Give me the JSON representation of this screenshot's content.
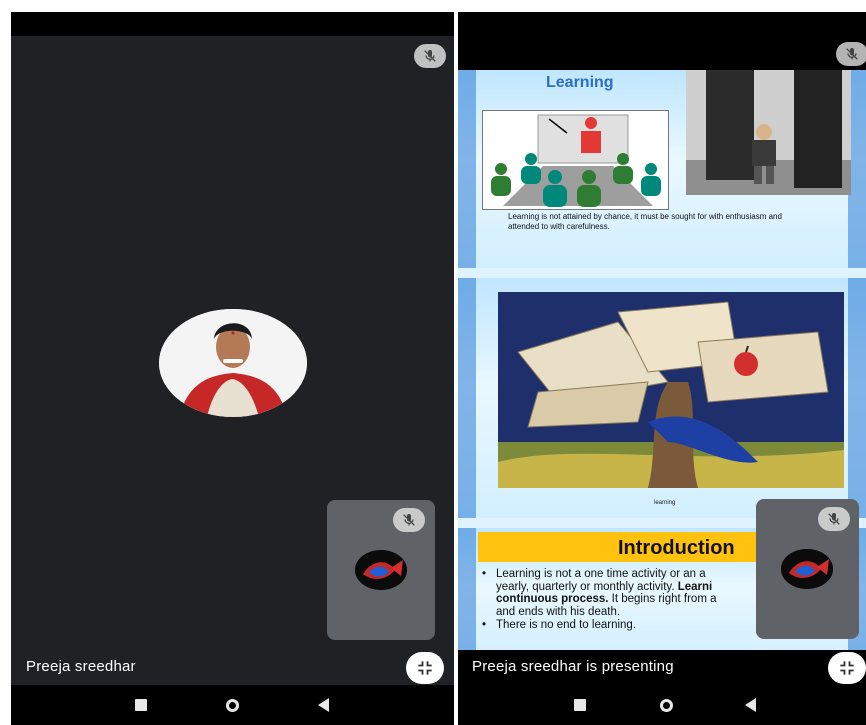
{
  "left_call": {
    "participant_name": "Preeja sreedhar",
    "icons": {
      "mute": "mic-off-icon",
      "exit_fullscreen": "exit-fullscreen-icon"
    }
  },
  "right_call": {
    "presenting_label": "Preeja sreedhar is presenting",
    "slides": {
      "slide1": {
        "title": "Learning",
        "caption": "Learning is not attained by chance, it must be sought for with enthusiasm and attended to with carefulness."
      },
      "slide2": {
        "caption": "learning"
      },
      "slide3": {
        "title": "Introduction",
        "bullet1_start": "Learning is not a one time activity or an a",
        "bullet1_mid": "yearly, quarterly or monthly activity. ",
        "bullet1_bold1": "Learni",
        "bullet1_bold2": "continuous process.",
        "bullet1_end": " It begins right from a",
        "bullet1_last": "and ends with his death.",
        "bullet2": "There is no end to learning."
      }
    }
  },
  "nav": {
    "icons": [
      "recents-icon",
      "home-icon",
      "back-icon"
    ]
  },
  "colors": {
    "call_bg": "#202124",
    "tile_bg": "#5f6368",
    "slide_blue": "#2d7ed6",
    "banner_yellow": "#ffc20e"
  }
}
